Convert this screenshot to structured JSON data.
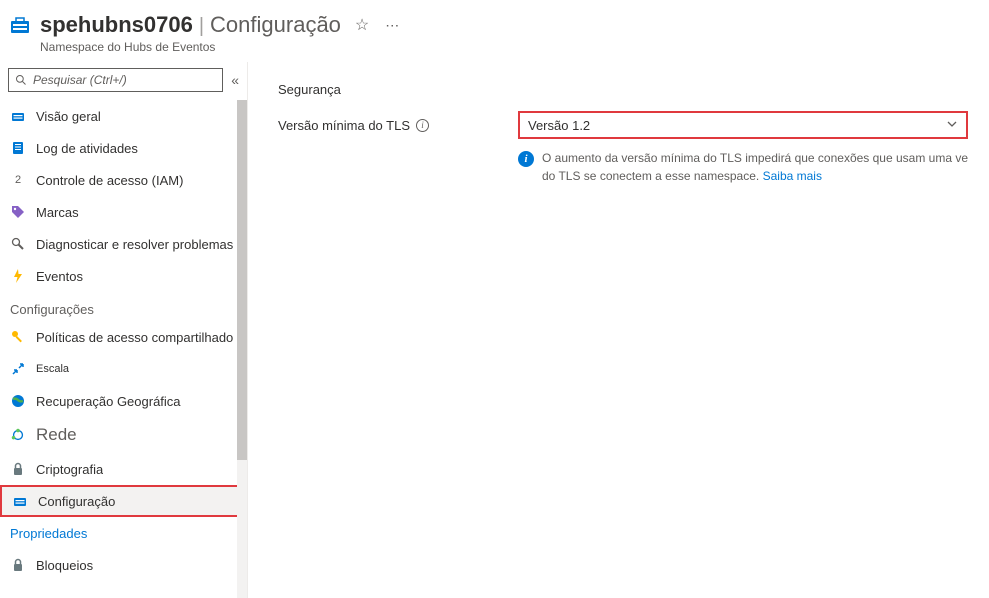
{
  "header": {
    "resource_name": "spehubns0706",
    "separator": "|",
    "page_title": "Configuração",
    "subtitle": "Namespace do Hubs de Eventos"
  },
  "search": {
    "placeholder": "Pesquisar (Ctrl+/)"
  },
  "nav": {
    "overview": "Visão geral",
    "activity_log": "Log de atividades",
    "access_control": "Controle de acesso (IAM)",
    "tags": "Marcas",
    "diagnose": "Diagnosticar e resolver problemas",
    "events": "Eventos",
    "settings_header": "Configurações",
    "shared_access": "Políticas de acesso compartilhado",
    "scale": "Escala",
    "geo_recovery": "Recuperação Geográfica",
    "networking": "Rede",
    "encryption": "Criptografia",
    "configuration": "Configuração",
    "properties": "Propriedades",
    "locks": "Bloqueios"
  },
  "content": {
    "security_heading": "Segurança",
    "tls_label": "Versão mínima do TLS",
    "tls_value": "Versão 1.2",
    "info_text_1": "O aumento da versão mínima do TLS impedirá que conexões que usam uma ve",
    "info_text_2": "do TLS se conectem a esse namespace.",
    "learn_more": "Saiba mais"
  }
}
